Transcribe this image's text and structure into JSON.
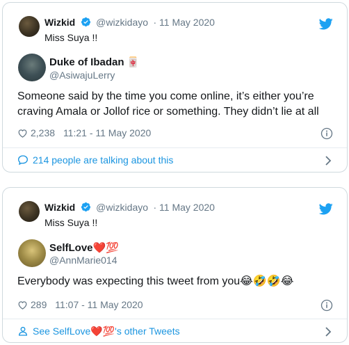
{
  "tweets": [
    {
      "outer": {
        "name": "Wizkid",
        "handle": "@wizkidayo",
        "date": "· 11 May 2020",
        "text": "Miss Suya !!"
      },
      "quoted": {
        "name": "Duke of Ibadan",
        "badge": "🀄",
        "handle": "@AsiwajuLerry",
        "text": "Someone said by the time you come online, it’s either you’re craving Amala or Jollof rice or something. They didn’t lie at all",
        "likes": "2,238",
        "time": "11:21 - 11 May 2020"
      },
      "footer": {
        "icon": "comment-icon",
        "label": "214 people are talking about this"
      }
    },
    {
      "outer": {
        "name": "Wizkid",
        "handle": "@wizkidayo",
        "date": "· 11 May 2020",
        "text": "Miss Suya !!"
      },
      "quoted": {
        "name": "SelfLove❤️💯",
        "badge": "",
        "handle": "@AnnMarie014",
        "text": "Everybody was expecting this tweet from you😂🤣🤣😂",
        "likes": "289",
        "time": "11:07 - 11 May 2020"
      },
      "footer": {
        "icon": "person-icon",
        "label": "See SelfLove❤️💯's other Tweets"
      }
    }
  ],
  "colors": {
    "link": "#1b95e0",
    "muted": "#657786",
    "twitter_blue": "#1da1f2"
  }
}
